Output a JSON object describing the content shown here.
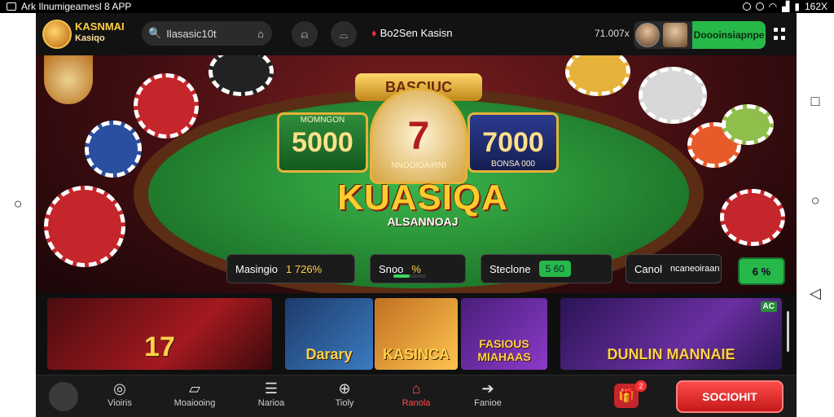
{
  "status_bar": {
    "left_text": "Ark  Ilnumigeamesl 8  APP",
    "right_text": "162X"
  },
  "header": {
    "logo_text": "KASNMAI",
    "logo_sub": "Kasiqo",
    "search_placeholder": "Ilasasic10t",
    "promo_text": "Bo2Sen Kasisn",
    "balance": "71.007x",
    "deposit_label": "Doooinsiapnpe"
  },
  "hero": {
    "banner_top": "BASCIUC",
    "left_value": "5000",
    "left_caption": "MOMNGON",
    "center_value": "7",
    "center_caption": "NNOOIOAIRNI",
    "right_value": "7000",
    "right_caption": "BONSA 000",
    "title": "KUASIQA",
    "subtitle": "ALSANNOAJ",
    "stats": [
      {
        "label": "Masingio",
        "value": "1 726%"
      },
      {
        "label": "Snoo",
        "value": "%"
      },
      {
        "label": "Steclone",
        "value": "5 60"
      },
      {
        "label": "Canol",
        "value": "ncaneoiraan"
      }
    ],
    "mini_button": "6 %",
    "progress_fraction": 0.5
  },
  "games": [
    {
      "title": "17",
      "badge": ""
    },
    {
      "title": "Darary",
      "badge": ""
    },
    {
      "title": "KASINCA",
      "badge": ""
    },
    {
      "title": "FASIOUS MIAHAAS",
      "badge": ""
    },
    {
      "title": "DUNLIN  MANNAIE",
      "badge": "AC"
    }
  ],
  "bottom_nav": {
    "items": [
      {
        "label": "Vioiris",
        "icon": "chips-icon"
      },
      {
        "label": "Moaiooing",
        "icon": "cards-icon"
      },
      {
        "label": "Narioa",
        "icon": "list-icon"
      },
      {
        "label": "Tioly",
        "icon": "info-icon"
      },
      {
        "label": "Ranola",
        "icon": "slot-icon"
      },
      {
        "label": "Fanioe",
        "icon": "arrow-icon"
      }
    ],
    "gift_count": "2",
    "cta_label": "SOCIOHIT"
  },
  "colors": {
    "accent_green": "#27b84a",
    "accent_red": "#c41a1a",
    "gold": "#ffcc2e"
  }
}
